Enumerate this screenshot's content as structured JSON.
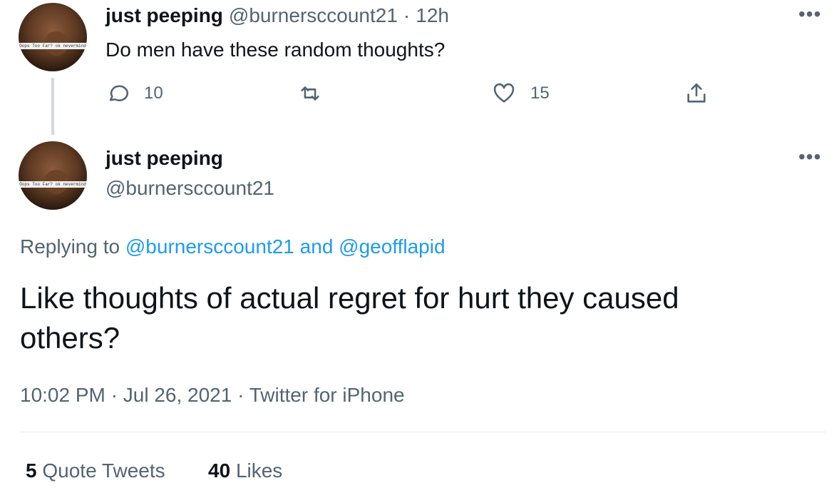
{
  "first_tweet": {
    "name": "just peeping",
    "handle": "@burnersccount21",
    "separator": "·",
    "time": "12h",
    "text": "Do men have these random thoughts?",
    "reply_count": "10",
    "like_count": "15",
    "avatar_caption": "Oops Too Far? ok nevermind"
  },
  "main_tweet": {
    "name": "just peeping",
    "handle": "@burnersccount21",
    "replying_prefix": "Replying to",
    "replying_user1": "@burnersccount21",
    "replying_and": "and",
    "replying_user2": "@geofflapid",
    "text": "Like thoughts of actual regret for hurt they caused others?",
    "time": "10:02 PM",
    "separator": "·",
    "date": "Jul 26, 2021",
    "source": "Twitter for iPhone",
    "avatar_caption": "Oops Too Far? ok nevermind"
  },
  "stats": {
    "quote_count": "5",
    "quote_label": "Quote Tweets",
    "like_count": "40",
    "like_label": "Likes"
  },
  "icons": {
    "more": "more-icon",
    "reply": "reply-icon",
    "retweet": "retweet-icon",
    "like": "heart-icon",
    "share": "share-icon"
  }
}
